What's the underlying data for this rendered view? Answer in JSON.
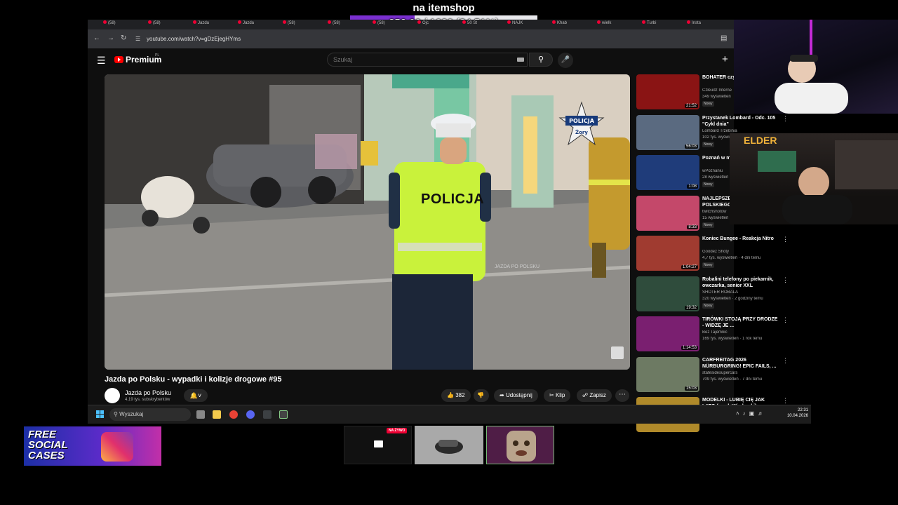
{
  "goal": {
    "title": "na itemshop",
    "progress_text": "352.00 / 1020 (34.51%)",
    "progress_fraction": 0.3451,
    "fill_color": "#7a2fd0"
  },
  "browser": {
    "tabs": [
      "(58)",
      "(58)",
      "Jazda",
      "Jazda",
      "(58)",
      "(58)",
      "(58)",
      "Ojc",
      "50 St",
      "NAJK",
      "Khab",
      "wielk",
      "Turbi",
      "Insta"
    ],
    "url": "youtube.com/watch?v=gDzEjegHYms"
  },
  "youtube": {
    "brand": "Premium",
    "brand_region": "PL",
    "search_placeholder": "Szukaj",
    "video": {
      "title": "Jazda po Polsku - wypadki i kolizje drogowe #95",
      "channel": "Jazda po Polsku",
      "subscribers": "4,19 tys. subskrybentów",
      "likes": "382",
      "share_label": "Udostępnij",
      "clip_label": "Klip",
      "save_label": "Zapisz",
      "vest_text": "POLICJA",
      "badge_text_top": "POLICJA",
      "badge_text_bottom": "Żory",
      "watermark": "JAZDA PO POLSKU"
    },
    "recommendations": [
      {
        "title": "BOHATER czy [BEDOES2115]",
        "channel": "Człeudz Interne",
        "meta": "349 wyświetleń",
        "badge": "Nowy",
        "duration": "21:52",
        "thumb_color": "#8a1414"
      },
      {
        "title": "Przystanek Lombard - Odc. 105 \"Cykl dnia\"",
        "channel": "Lombard Trzebinia",
        "meta": "102 tys. wyświetleń",
        "badge": "Nowy",
        "duration": "56:03",
        "thumb_color": "#5a6a80"
      },
      {
        "title": "Poznań w minucie",
        "channel": "wPoznaniu",
        "meta": "28 wyświetleń",
        "badge": "Nowy",
        "duration": "1:08",
        "thumb_color": "#1f3c7a"
      },
      {
        "title": "NAJLEPSZE TWITCHA POLSKIEGO",
        "channel": "twitchshotow",
        "meta": "15 wyświetleń",
        "badge": "Nowy",
        "duration": "8:33",
        "thumb_color": "#c4486a"
      },
      {
        "title": "Koniec Bungee - Reakcja Nitro",
        "channel": "Goodez Shoty",
        "meta": "4,7 tys. wyświetleń · 4 dni temu",
        "badge": "Nowy",
        "duration": "1:04:27",
        "thumb_color": "#a03b30"
      },
      {
        "title": "Robalini telefony po piekarnik, owczarka, senior XXL",
        "channel": "SHOTER ROBALA",
        "meta": "320 wyświetleń · 2 godziny temu",
        "badge": "Nowy",
        "duration": "19:32",
        "thumb_color": "#2f4c3c"
      },
      {
        "title": "TIRÓWKI STOJĄ PRZY DRODZE - WIDZĘ JE ...",
        "channel": "Bez Tajemnic",
        "meta": "169 tys. wyświetleń · 1 rok temu",
        "badge": "",
        "duration": "1:14:53",
        "thumb_color": "#7a1f70"
      },
      {
        "title": "CARFREITAG 2026 NÜRBURGRING! EPIC FAILS, ...",
        "channel": "statesidesupercars",
        "meta": "709 tys. wyświetleń · 7 dni temu",
        "badge": "",
        "duration": "15:03",
        "thumb_color": "#6d7a63"
      },
      {
        "title": "MODELKI - LUBIĘ CIĘ JAK LATO (prod. Wiederski)",
        "channel": "",
        "meta": "",
        "badge": "",
        "duration": "",
        "thumb_color": "#b08a2a"
      }
    ]
  },
  "taskbar": {
    "search_placeholder": "Wyszukaj",
    "time": "22:31",
    "date": "10.04.2026"
  },
  "overlays": {
    "cam2_label": "ELDER",
    "promo_text": "FREE SOCIAL CASES",
    "live_badge": "NA ŻYWO"
  }
}
